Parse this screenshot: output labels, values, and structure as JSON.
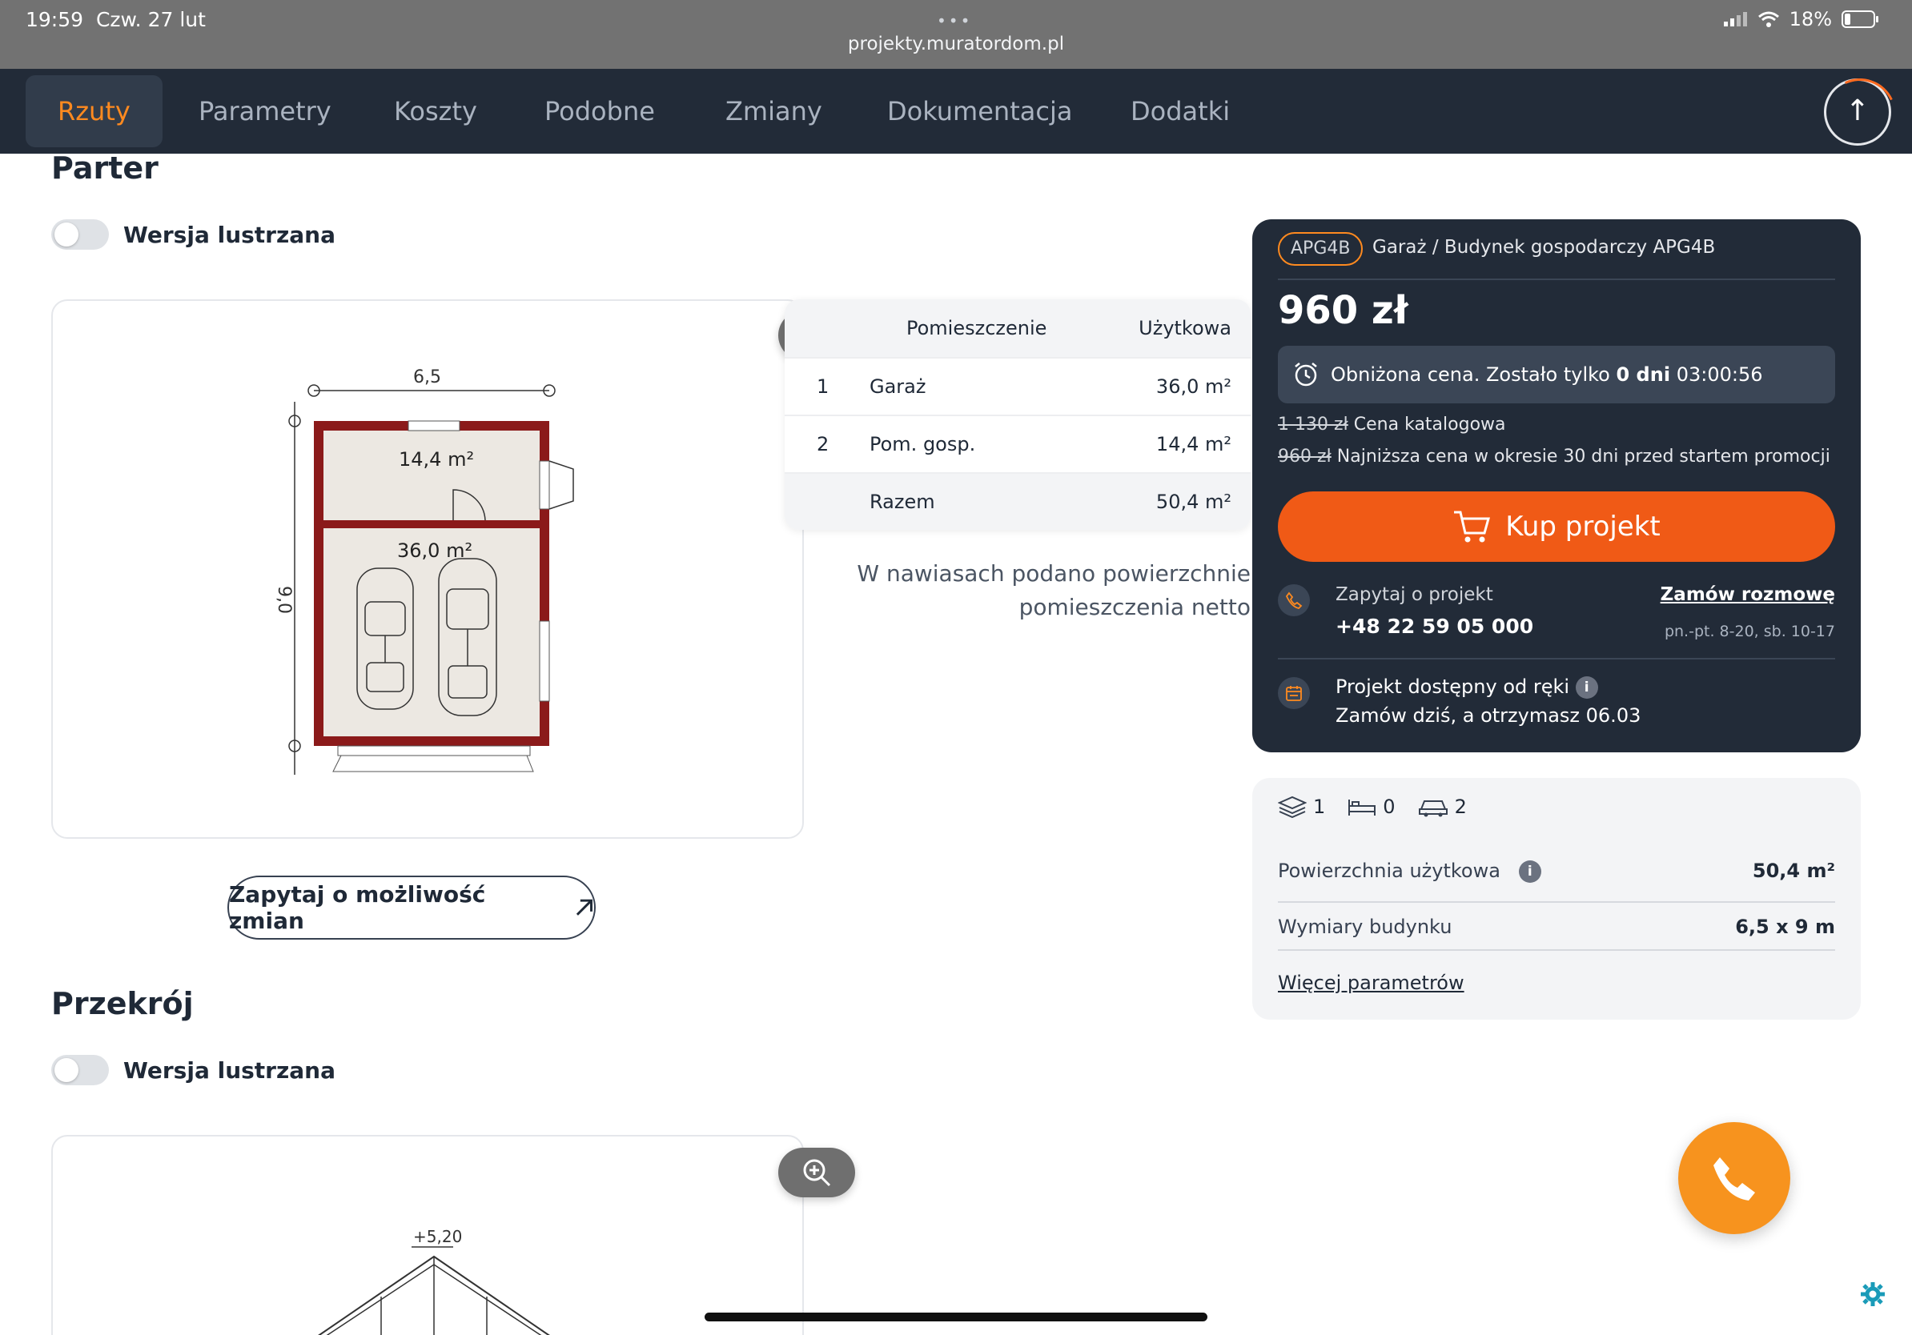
{
  "status": {
    "time": "19:59",
    "date": "Czw. 27 lut",
    "battery": "18%",
    "url": "projekty.muratordom.pl"
  },
  "nav": {
    "tabs": [
      "Rzuty",
      "Parametry",
      "Koszty",
      "Podobne",
      "Zmiany",
      "Dokumentacja",
      "Dodatki"
    ],
    "active": "Rzuty"
  },
  "parter": {
    "title": "Parter",
    "mirror_label": "Wersja lustrzana",
    "plan": {
      "width_dim": "6,5",
      "height_dim": "9,0",
      "room_top": "14,4 m²",
      "room_bottom": "36,0 m²"
    },
    "table": {
      "head_room": "Pomieszczenie",
      "head_area": "Użytkowa",
      "rows": [
        {
          "num": "1",
          "name": "Garaż",
          "area": "36,0",
          "unit": "m²"
        },
        {
          "num": "2",
          "name": "Pom. gosp.",
          "area": "14,4",
          "unit": "m²"
        }
      ],
      "total_label": "Razem",
      "total_area": "50,4",
      "total_unit": "m²"
    },
    "note_line1": "W nawiasach podano powierzchnie",
    "note_line2": "pomieszczenia netto",
    "change_button": "Zapytaj o możliwość zmian"
  },
  "przekroj": {
    "title": "Przekrój",
    "mirror_label": "Wersja lustrzana",
    "height_label": "+5,20"
  },
  "card": {
    "badge": "APG4B",
    "title": "Garaż / Budynek gospodarczy APG4B",
    "price": "960 zł",
    "promo_prefix": "Obniżona cena. Zostało tylko",
    "promo_days": "0 dni",
    "promo_time": "03:00:56",
    "catalog_price": "1 130 zł",
    "catalog_label": "Cena katalogowa",
    "lowest_price": "960 zł",
    "lowest_label": "Najniższa cena w okresie 30 dni przed startem promocji",
    "buy_button": "Kup projekt",
    "contact_label": "Zapytaj o projekt",
    "contact_phone": "+48 22 59 05 000",
    "order_call": "Zamów rozmowę",
    "hours": "pn.-pt. 8-20, sb. 10-17",
    "avail_title": "Projekt dostępny od ręki",
    "avail_sub": "Zamów dziś, a otrzymasz 06.03"
  },
  "params": {
    "floors": "1",
    "bedrooms": "0",
    "cars": "2",
    "area_label": "Powierzchnia użytkowa",
    "area_value": "50,4 m²",
    "dims_label": "Wymiary budynku",
    "dims_value": "6,5 x 9 m",
    "more_link": "Więcej parametrów"
  },
  "colors": {
    "accent": "#f05a16",
    "active_tab": "#ff8a1f",
    "dark": "#222b38",
    "wall": "#8b1a1a",
    "fab": "#f7931e"
  }
}
